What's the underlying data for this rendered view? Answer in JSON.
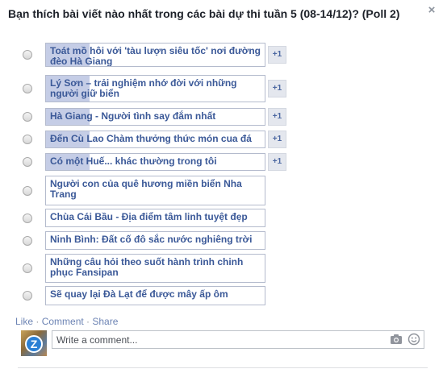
{
  "poll": {
    "title": "Bạn thích bài viết nào nhất trong các bài dự thi tuần 5 (08-14/12)? (Poll 2)",
    "close_icon": "close-icon",
    "options": [
      {
        "label": "Toát mồ hôi với 'tàu lượn siêu tốc' nơi đường đèo Hà Giang",
        "vote_fraction": 0.2,
        "plus": "+1"
      },
      {
        "label": "Lý Sơn – trải nghiệm nhớ đời với những người giữ biển",
        "vote_fraction": 0.2,
        "plus": "+1"
      },
      {
        "label": "Hà Giang - Người tình say đắm nhất",
        "vote_fraction": 0.2,
        "plus": "+1"
      },
      {
        "label": "Đến Cù Lao Chàm thưởng thức món cua đá",
        "vote_fraction": 0.2,
        "plus": "+1"
      },
      {
        "label": "Có một Huế... khác thường trong tôi",
        "vote_fraction": 0.2,
        "plus": "+1"
      },
      {
        "label": "Người con của quê hương miền biển Nha Trang",
        "vote_fraction": 0,
        "plus": ""
      },
      {
        "label": "Chùa Cái Bầu - Địa điểm tâm linh tuyệt đẹp",
        "vote_fraction": 0,
        "plus": ""
      },
      {
        "label": "Ninh Bình: Đất cố đô sắc nước nghiêng trời",
        "vote_fraction": 0,
        "plus": ""
      },
      {
        "label": "Những câu hỏi theo suốt hành trình chinh phục Fansipan",
        "vote_fraction": 0,
        "plus": ""
      },
      {
        "label": "Sẽ quay lại Đà Lạt để được mây ấp ôm",
        "vote_fraction": 0,
        "plus": ""
      }
    ]
  },
  "actions": {
    "like": "Like",
    "comment": "Comment",
    "share": "Share",
    "separator": " · "
  },
  "comment": {
    "placeholder": "Write a comment...",
    "avatar_letter": "Z",
    "camera_icon": "camera-icon",
    "emoji_icon": "smiley-icon"
  },
  "colors": {
    "link": "#3b5998",
    "fill": "#c5cde6",
    "border": "#b4bbcd"
  }
}
